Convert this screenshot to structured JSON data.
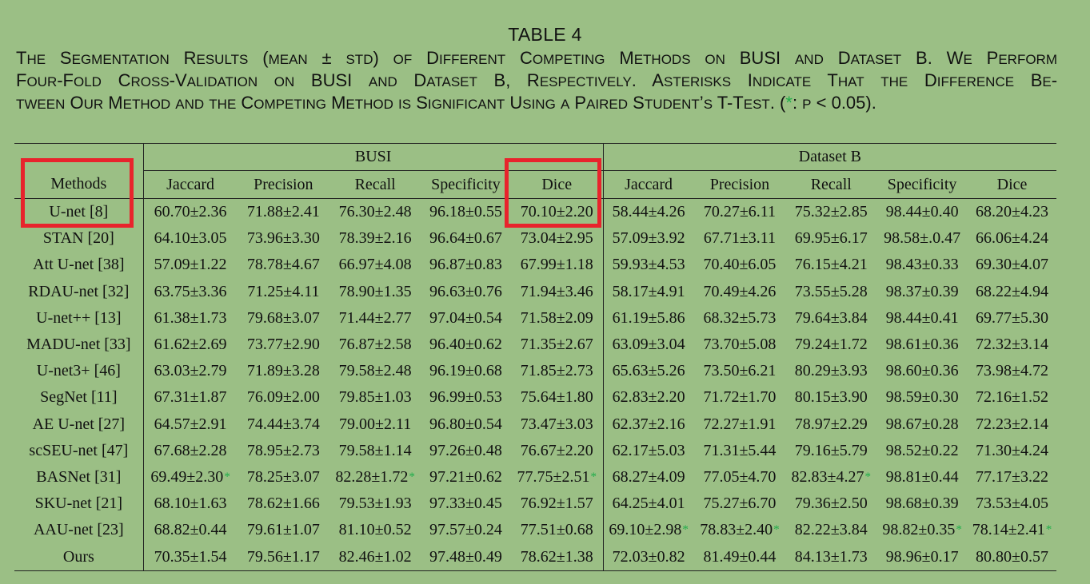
{
  "caption": {
    "title": "TABLE 4",
    "line1": "The Segmentation Results (mean ± std) of Different Competing Methods on BUSI and Dataset B. We Perform",
    "line2": "Four-Fold Cross-Validation on BUSI and Dataset B, Respectively. Asterisks Indicate That the Difference Be-",
    "line3_a": "tween Our Method and the Competing Method is Significant Using a Paired Student’s T-Test. (",
    "line3_star": "*",
    "line3_b": ": p < 0.05)."
  },
  "table": {
    "groups": [
      "BUSI",
      "Dataset B"
    ],
    "method_header": "Methods",
    "columns": [
      "Jaccard",
      "Precision",
      "Recall",
      "Specificity",
      "Dice",
      "Jaccard",
      "Precision",
      "Recall",
      "Specificity",
      "Dice"
    ],
    "rows": [
      {
        "method": "U-net [8]",
        "cells": [
          {
            "v": "60.70±2.36"
          },
          {
            "v": "71.88±2.41"
          },
          {
            "v": "76.30±2.48"
          },
          {
            "v": "96.18±0.55"
          },
          {
            "v": "70.10±2.20"
          },
          {
            "v": "58.44±4.26"
          },
          {
            "v": "70.27±6.11"
          },
          {
            "v": "75.32±2.85"
          },
          {
            "v": "98.44±0.40"
          },
          {
            "v": "68.20±4.23"
          }
        ]
      },
      {
        "method": "STAN [20]",
        "cells": [
          {
            "v": "64.10±3.05"
          },
          {
            "v": "73.96±3.30"
          },
          {
            "v": "78.39±2.16"
          },
          {
            "v": "96.64±0.67"
          },
          {
            "v": "73.04±2.95"
          },
          {
            "v": "57.09±3.92"
          },
          {
            "v": "67.71±3.11"
          },
          {
            "v": "69.95±6.17"
          },
          {
            "v": "98.58±.0.47"
          },
          {
            "v": "66.06±4.24"
          }
        ]
      },
      {
        "method": "Att U-net [38]",
        "cells": [
          {
            "v": "57.09±1.22"
          },
          {
            "v": "78.78±4.67"
          },
          {
            "v": "66.97±4.08"
          },
          {
            "v": "96.87±0.83"
          },
          {
            "v": "67.99±1.18"
          },
          {
            "v": "59.93±4.53"
          },
          {
            "v": "70.40±6.05"
          },
          {
            "v": "76.15±4.21"
          },
          {
            "v": "98.43±0.33"
          },
          {
            "v": "69.30±4.07"
          }
        ]
      },
      {
        "method": "RDAU-net [32]",
        "cells": [
          {
            "v": "63.75±3.36"
          },
          {
            "v": "71.25±4.11"
          },
          {
            "v": "78.90±1.35"
          },
          {
            "v": "96.63±0.76"
          },
          {
            "v": "71.94±3.46"
          },
          {
            "v": "58.17±4.91"
          },
          {
            "v": "70.49±4.26"
          },
          {
            "v": "73.55±5.28"
          },
          {
            "v": "98.37±0.39"
          },
          {
            "v": "68.22±4.94"
          }
        ]
      },
      {
        "method": "U-net++ [13]",
        "cells": [
          {
            "v": "61.38±1.73"
          },
          {
            "v": "79.68±3.07"
          },
          {
            "v": "71.44±2.77"
          },
          {
            "v": "97.04±0.54"
          },
          {
            "v": "71.58±2.09"
          },
          {
            "v": "61.19±5.86"
          },
          {
            "v": "68.32±5.73"
          },
          {
            "v": "79.64±3.84"
          },
          {
            "v": "98.44±0.41"
          },
          {
            "v": "69.77±5.30"
          }
        ]
      },
      {
        "method": "MADU-net [33]",
        "cells": [
          {
            "v": "61.62±2.69"
          },
          {
            "v": "73.77±2.90"
          },
          {
            "v": "76.87±2.58"
          },
          {
            "v": "96.40±0.62"
          },
          {
            "v": "71.35±2.67"
          },
          {
            "v": "63.09±3.04"
          },
          {
            "v": "73.70±5.08"
          },
          {
            "v": "79.24±1.72"
          },
          {
            "v": "98.61±0.36"
          },
          {
            "v": "72.32±3.14"
          }
        ]
      },
      {
        "method": "U-net3+ [46]",
        "cells": [
          {
            "v": "63.03±2.79"
          },
          {
            "v": "71.89±3.28"
          },
          {
            "v": "79.58±2.48"
          },
          {
            "v": "96.19±0.68"
          },
          {
            "v": "71.85±2.73"
          },
          {
            "v": "65.63±5.26"
          },
          {
            "v": "73.50±6.21"
          },
          {
            "v": "80.29±3.93"
          },
          {
            "v": "98.60±0.36"
          },
          {
            "v": "73.98±4.72"
          }
        ]
      },
      {
        "method": "SegNet [11]",
        "cells": [
          {
            "v": "67.31±1.87"
          },
          {
            "v": "76.09±2.00"
          },
          {
            "v": "79.85±1.03"
          },
          {
            "v": "96.99±0.53"
          },
          {
            "v": "75.64±1.80"
          },
          {
            "v": "62.83±2.20"
          },
          {
            "v": "71.72±1.70"
          },
          {
            "v": "80.15±3.90"
          },
          {
            "v": "98.59±0.30"
          },
          {
            "v": "72.16±1.52"
          }
        ]
      },
      {
        "method": "AE U-net [27]",
        "cells": [
          {
            "v": "64.57±2.91"
          },
          {
            "v": "74.44±3.74"
          },
          {
            "v": "79.00±2.11"
          },
          {
            "v": "96.80±0.54"
          },
          {
            "v": "73.47±3.03"
          },
          {
            "v": "62.37±2.16"
          },
          {
            "v": "72.27±1.91"
          },
          {
            "v": "78.97±2.29"
          },
          {
            "v": "98.67±0.28"
          },
          {
            "v": "72.23±2.14"
          }
        ]
      },
      {
        "method": "scSEU-net [47]",
        "cells": [
          {
            "v": "67.68±2.28"
          },
          {
            "v": "78.95±2.73"
          },
          {
            "v": "79.58±1.14"
          },
          {
            "v": "97.26±0.48"
          },
          {
            "v": "76.67±2.20"
          },
          {
            "v": "62.17±5.03"
          },
          {
            "v": "71.31±5.44"
          },
          {
            "v": "79.16±5.79"
          },
          {
            "v": "98.52±0.22"
          },
          {
            "v": "71.30±4.24"
          }
        ]
      },
      {
        "method": "BASNet [31]",
        "cells": [
          {
            "v": "69.49±2.30",
            "s": true
          },
          {
            "v": "78.25±3.07"
          },
          {
            "v": "82.28±1.72",
            "s": true
          },
          {
            "v": "97.21±0.62"
          },
          {
            "v": "77.75±2.51",
            "s": true
          },
          {
            "v": "68.27±4.09"
          },
          {
            "v": "77.05±4.70"
          },
          {
            "v": "82.83±4.27",
            "s": true
          },
          {
            "v": "98.81±0.44"
          },
          {
            "v": "77.17±3.22"
          }
        ]
      },
      {
        "method": "SKU-net [21]",
        "cells": [
          {
            "v": "68.10±1.63"
          },
          {
            "v": "78.62±1.66"
          },
          {
            "v": "79.53±1.93"
          },
          {
            "v": "97.33±0.45"
          },
          {
            "v": "76.92±1.57"
          },
          {
            "v": "64.25±4.01"
          },
          {
            "v": "75.27±6.70"
          },
          {
            "v": "79.36±2.50"
          },
          {
            "v": "98.68±0.39"
          },
          {
            "v": "73.53±4.05"
          }
        ]
      },
      {
        "method": "AAU-net [23]",
        "cells": [
          {
            "v": "68.82±0.44"
          },
          {
            "v": "79.61±1.07",
            "b": true
          },
          {
            "v": "81.10±0.52"
          },
          {
            "v": "97.57±0.24",
            "b": true
          },
          {
            "v": "77.51±0.68"
          },
          {
            "v": "69.10±2.98",
            "s": true
          },
          {
            "v": "78.83±2.40",
            "s": true
          },
          {
            "v": "82.22±3.84"
          },
          {
            "v": "98.82±0.35",
            "s": true
          },
          {
            "v": "78.14±2.41",
            "s": true
          }
        ]
      },
      {
        "method": "Ours",
        "cells": [
          {
            "v": "70.35±1.54",
            "b": true
          },
          {
            "v": "79.56±1.17"
          },
          {
            "v": "82.46±1.02",
            "b": true
          },
          {
            "v": "97.48±0.49"
          },
          {
            "v": "78.62±1.38",
            "b": true
          },
          {
            "v": "72.03±0.82",
            "b": true
          },
          {
            "v": "81.49±0.44",
            "b": true
          },
          {
            "v": "84.13±1.73",
            "b": true
          },
          {
            "v": "98.96±0.17",
            "b": true
          },
          {
            "v": "80.80±0.57",
            "b": true
          }
        ]
      }
    ]
  },
  "colors": {
    "background": "#9bbf85",
    "highlight": "#e8232c",
    "asterisk": "#1fae4a"
  }
}
